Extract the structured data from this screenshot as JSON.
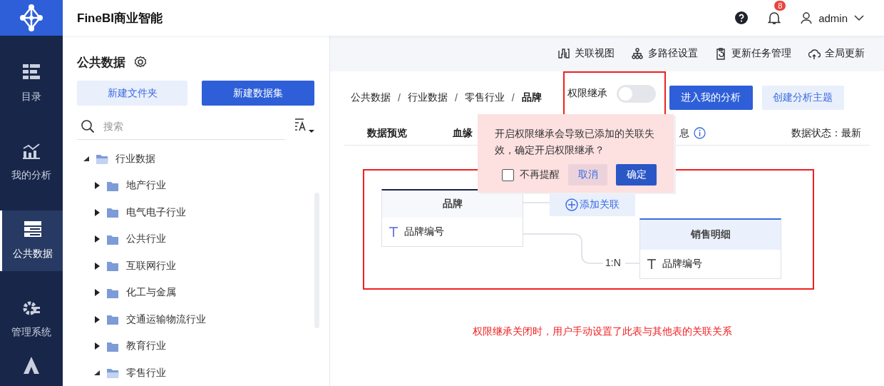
{
  "app": {
    "title": "FineBI商业智能",
    "notifications": "8",
    "user": "admin"
  },
  "nav": [
    {
      "label": "目录",
      "selected": false
    },
    {
      "label": "我的分析",
      "selected": false
    },
    {
      "label": "公共数据",
      "selected": true
    },
    {
      "label": "管理系统",
      "selected": false
    }
  ],
  "panel": {
    "title": "公共数据",
    "buttons": [
      {
        "label": "新建文件夹",
        "kind": "secondary"
      },
      {
        "label": "新建数据集",
        "kind": "primary"
      }
    ],
    "search": {
      "placeholder": "搜索"
    },
    "tree": [
      {
        "label": "行业数据",
        "expanded": true,
        "children": [
          {
            "label": "地产行业",
            "expanded": false
          },
          {
            "label": "电气电子行业",
            "expanded": false
          },
          {
            "label": "公共行业",
            "expanded": false
          },
          {
            "label": "互联网行业",
            "expanded": false
          },
          {
            "label": "化工与金属",
            "expanded": false
          },
          {
            "label": "交通运输物流行业",
            "expanded": false
          },
          {
            "label": "教育行业",
            "expanded": false
          },
          {
            "label": "零售行业",
            "expanded": true
          }
        ]
      }
    ]
  },
  "toolbar": [
    "关联视图",
    "多路径设置",
    "更新任务管理",
    "全局更新"
  ],
  "breadcrumb": [
    {
      "kind": "link",
      "label": "公共数据"
    },
    {
      "kind": "separator",
      "label": "/"
    },
    {
      "kind": "link",
      "label": "行业数据"
    },
    {
      "kind": "separator",
      "label": "/"
    },
    {
      "kind": "link",
      "label": "零售行业"
    },
    {
      "kind": "separator",
      "label": "/"
    },
    {
      "kind": "current",
      "label": "品牌"
    }
  ],
  "permission": {
    "label": "权限继承",
    "on": false
  },
  "actions": [
    {
      "label": "进入我的分析",
      "kind": "primary"
    },
    {
      "label": "创建分析主题",
      "kind": "secondary"
    }
  ],
  "tabs": [
    "数据预览",
    "血缘",
    "息"
  ],
  "data_status": "数据状态：最新",
  "popup": {
    "message": "开启权限继承会导致已添加的关联失效，确定开启权限继承？",
    "dont_remind": {
      "label": "不再提醒",
      "checked": false
    },
    "buttons": [
      {
        "label": "取消",
        "kind": "secondary"
      },
      {
        "label": "确定",
        "kind": "primary"
      }
    ]
  },
  "diagram": {
    "tables": [
      {
        "name": "品牌",
        "kind": "source",
        "fields": [
          "品牌编号"
        ]
      },
      {
        "name": "销售明细",
        "kind": "target",
        "fields": [
          "品牌编号"
        ]
      }
    ],
    "add_link": "添加关联",
    "relation": "1:N"
  },
  "annotation": "权限继承关闭时，用户手动设置了此表与其他表的关联关系"
}
